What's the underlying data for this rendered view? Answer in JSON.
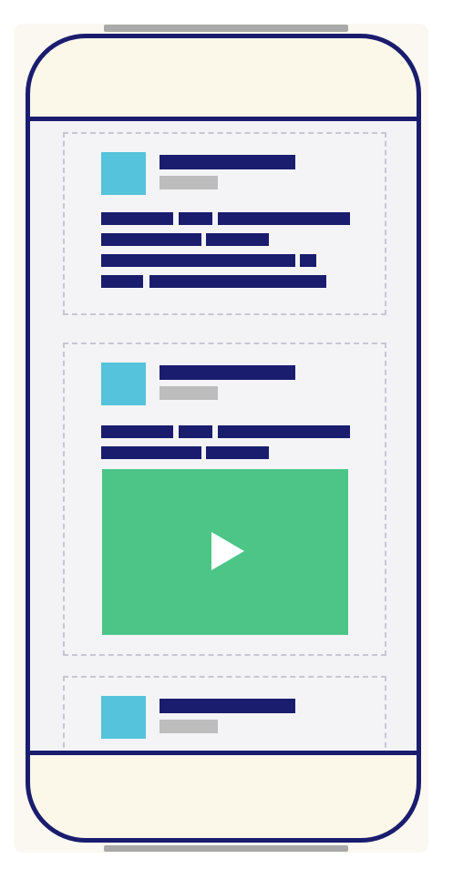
{
  "illustration": {
    "cards": [
      {
        "kind": "text-post",
        "text_lines": 4,
        "has_video": false
      },
      {
        "kind": "video-post",
        "text_lines": 2,
        "has_video": true
      },
      {
        "kind": "text-post",
        "text_lines": 0,
        "has_video": false,
        "partially_visible": true
      }
    ],
    "icons": [
      "play-icon"
    ],
    "colors": {
      "phone_outline": "#1a1d6e",
      "phone_body": "#fbf8ea",
      "screen_background": "#f3f3f6",
      "card_border": "#c7c7d3",
      "avatar": "#56c3dc",
      "text_bar": "#1a1d6e",
      "meta_bar": "#bdbdbd",
      "video": "#4cc586",
      "play_icon": "#ffffff",
      "cable": "#a9a9a9"
    }
  }
}
